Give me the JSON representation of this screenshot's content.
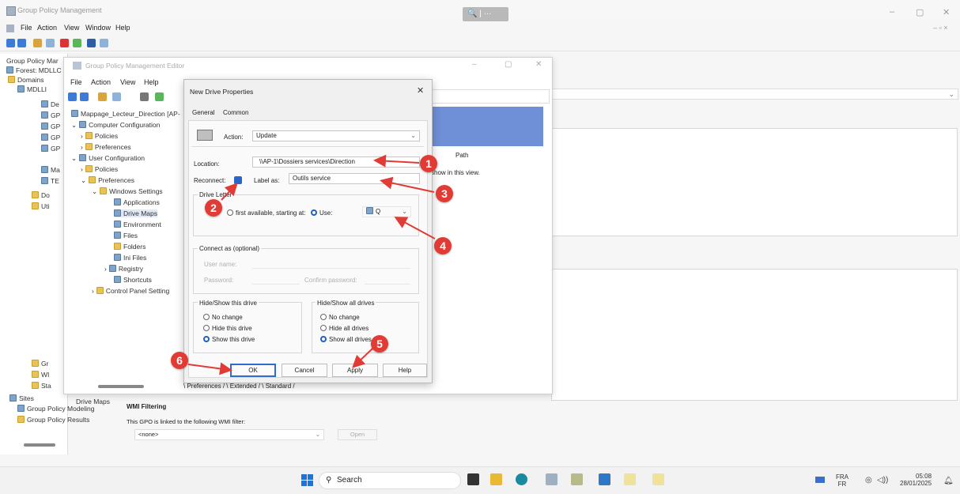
{
  "app": {
    "title": "Group Policy Management",
    "search_label": "🔍 | ···",
    "window_controls": [
      "–",
      "▢",
      "✕"
    ],
    "inner_controls": "–  ▫  ×"
  },
  "menu": [
    "File",
    "Action",
    "View",
    "Window",
    "Help"
  ],
  "left_tree": {
    "header": "Group Policy Mar",
    "items": [
      "Forest: MDLLC",
      "Domains",
      "MDLLI",
      "De",
      "GP",
      "GP",
      "GP",
      "GP",
      "Ma",
      "TE",
      "Do",
      "Uti"
    ],
    "bottom_items": [
      "Gr",
      "WI",
      "Sta",
      "Sites",
      "Group Policy Modeling",
      "Group Policy Results"
    ]
  },
  "editor": {
    "title": "Group Policy Management Editor",
    "menu": [
      "File",
      "Action",
      "View",
      "Help"
    ],
    "tree": {
      "root": "Mappage_Lecteur_Direction [AP-",
      "computer_config": "Computer Configuration",
      "cc_policies": "Policies",
      "cc_preferences": "Preferences",
      "user_config": "User Configuration",
      "uc_policies": "Policies",
      "uc_preferences": "Preferences",
      "windows_settings": "Windows Settings",
      "applications": "Applications",
      "drive_maps": "Drive Maps",
      "environment": "Environment",
      "files": "Files",
      "folders": "Folders",
      "ini_files": "Ini Files",
      "registry": "Registry",
      "shortcuts": "Shortcuts",
      "control_panel": "Control Panel Setting"
    },
    "status": "Drive Maps",
    "right": {
      "path_header": "Path",
      "empty_msg": "show in this view."
    },
    "tabs": [
      "Preferences",
      "Extended",
      "Standard"
    ]
  },
  "dialog": {
    "title": "New Drive Properties",
    "tabs": [
      "General",
      "Common"
    ],
    "action_label": "Action:",
    "action_value": "Update",
    "location_label": "Location:",
    "location_value": "\\\\AP-1\\Dossiers services\\Direction",
    "reconnect_label": "Reconnect:",
    "label_as_label": "Label as:",
    "label_as_value": "Outils service",
    "drive_letter_group": "Drive Letter",
    "first_available": "first available, starting at:",
    "use_label": "Use:",
    "use_value": "Q",
    "connect_as_group": "Connect as (optional)",
    "user_name_label": "User name:",
    "password_label": "Password:",
    "confirm_password_label": "Confirm password:",
    "hide_show_drive_group": "Hide/Show this drive",
    "hsd_options": [
      "No change",
      "Hide this drive",
      "Show this drive"
    ],
    "hide_show_all_group": "Hide/Show all drives",
    "hsa_options": [
      "No change",
      "Hide all drives",
      "Show all drives"
    ],
    "buttons": {
      "ok": "OK",
      "cancel": "Cancel",
      "apply": "Apply",
      "help": "Help"
    }
  },
  "markers": [
    "1",
    "2",
    "3",
    "4",
    "5",
    "6"
  ],
  "wmi": {
    "title": "WMI Filtering",
    "desc": "This GPO is linked to the following WMI filter:",
    "select": "<none>",
    "open": "Open"
  },
  "taskbar": {
    "search": "Search",
    "lang_top": "FRA",
    "lang_bottom": "FR",
    "time": "05:08",
    "date": "28/01/2025"
  },
  "colors": {
    "accent": "#2f6bd0",
    "marker": "#e23b35",
    "pane_blue": "#6f8fd6"
  }
}
